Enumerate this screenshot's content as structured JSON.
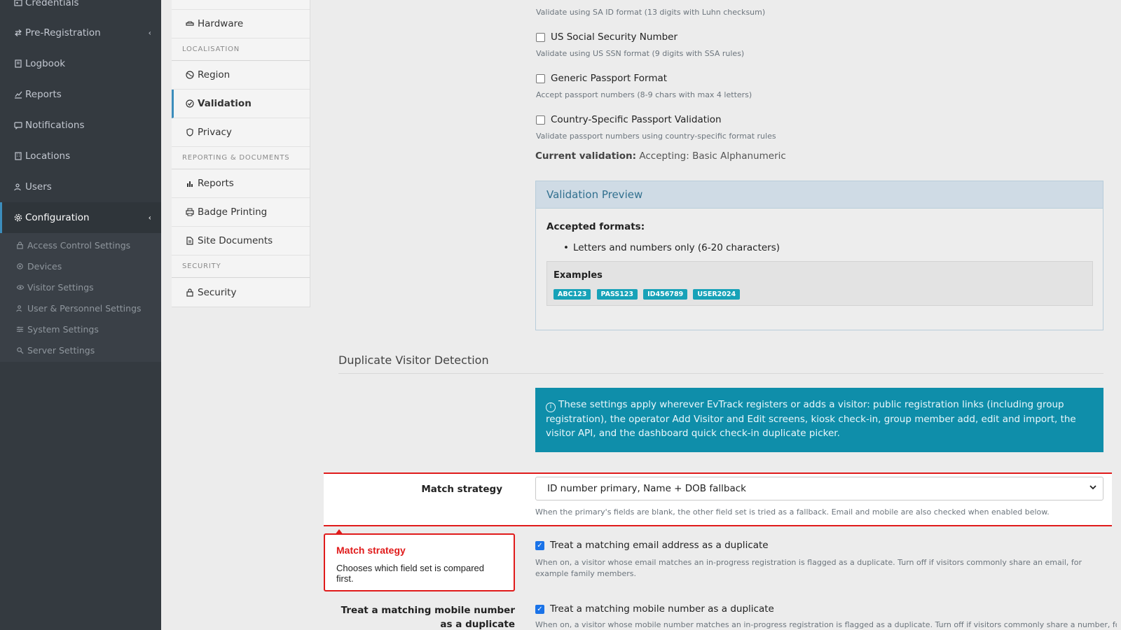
{
  "sidebar": {
    "items": [
      {
        "label": "Credentials",
        "icon": "id-card-icon"
      },
      {
        "label": "Pre-Registration",
        "icon": "exchange-icon",
        "chevron": "‹"
      },
      {
        "label": "Logbook",
        "icon": "book-icon"
      },
      {
        "label": "Reports",
        "icon": "chart-icon"
      },
      {
        "label": "Notifications",
        "icon": "chat-icon"
      },
      {
        "label": "Locations",
        "icon": "building-icon"
      },
      {
        "label": "Users",
        "icon": "users-icon"
      },
      {
        "label": "Configuration",
        "icon": "gear-icon",
        "chevron": "‹"
      }
    ],
    "sub_items": [
      {
        "label": "Access Control Settings",
        "icon": "lock-icon"
      },
      {
        "label": "Devices",
        "icon": "device-icon"
      },
      {
        "label": "Visitor Settings",
        "icon": "eye-icon"
      },
      {
        "label": "User & Personnel Settings",
        "icon": "user-cog-icon"
      },
      {
        "label": "System Settings",
        "icon": "sliders-icon"
      },
      {
        "label": "Server Settings",
        "icon": "server-icon"
      }
    ]
  },
  "settings_menu": {
    "hardware": "Hardware",
    "section_localisation": "LOCALISATION",
    "region": "Region",
    "validation": "Validation",
    "privacy": "Privacy",
    "section_reporting": "REPORTING & DOCUMENTS",
    "reports": "Reports",
    "badge_printing": "Badge Printing",
    "site_documents": "Site Documents",
    "section_security": "SECURITY",
    "security": "Security"
  },
  "validation": {
    "sa_id_help": "Validate using SA ID format (13 digits with Luhn checksum)",
    "ssn_label": "US Social Security Number",
    "ssn_help": "Validate using US SSN format (9 digits with SSA rules)",
    "passport_label": "Generic Passport Format",
    "passport_help": "Accept passport numbers (8-9 chars with max 4 letters)",
    "country_label": "Country-Specific Passport Validation",
    "country_help": "Validate passport numbers using country-specific format rules",
    "current_label": "Current validation:",
    "current_value": "Accepting: Basic Alphanumeric"
  },
  "preview": {
    "title": "Validation Preview",
    "accepted_label": "Accepted formats:",
    "accepted_item": "Letters and numbers only (6-20 characters)",
    "examples_label": "Examples",
    "examples": [
      "ABC123",
      "PASS123",
      "ID456789",
      "USER2024"
    ]
  },
  "duplicate": {
    "heading": "Duplicate Visitor Detection",
    "info": "These settings apply wherever EvTrack registers or adds a visitor: public registration links (including group registration), the operator Add Visitor and Edit screens, kiosk check-in, group member add, edit and import, the visitor API, and the dashboard quick check-in duplicate picker.",
    "match_label": "Match strategy",
    "match_value": "ID number primary, Name + DOB fallback",
    "match_help": "When the primary's fields are blank, the other field set is tried as a fallback. Email and mobile are also checked when enabled below.",
    "email_label": "Treat a matching email address as a duplicate",
    "email_help": "When on, a visitor whose email matches an in-progress registration is flagged as a duplicate. Turn off if visitors commonly share an email, for example family members.",
    "mobile_row_label": "Treat a matching mobile number as a duplicate",
    "mobile_label": "Treat a matching mobile number as a duplicate",
    "mobile_help": "When on, a visitor whose mobile number matches an in-progress registration is flagged as a duplicate. Turn off if visitors commonly share a number, for example a"
  },
  "tooltip": {
    "title": "Match strategy",
    "body": "Chooses which field set is compared first."
  }
}
